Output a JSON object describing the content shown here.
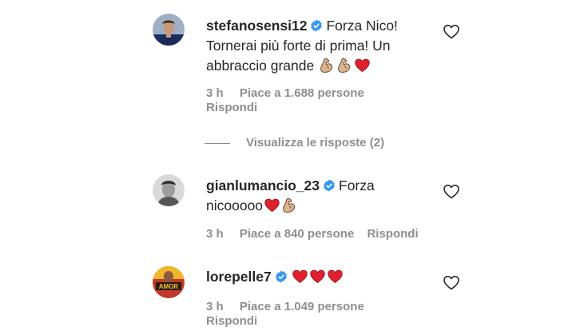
{
  "comments": [
    {
      "username": "stefanosensi12",
      "verified": true,
      "text_lines": [
        "Forza Nico!",
        "Tornerai più forte di prima! Un",
        "abbraccio grande"
      ],
      "emojis": [
        "flexed-biceps",
        "flexed-biceps",
        "red-heart"
      ],
      "time": "3 h",
      "likes": "Piace a 1.688 persone",
      "reply": "Rispondi",
      "view_replies": "Visualizza le risposte (2)"
    },
    {
      "username": "gianlumancio_23",
      "verified": true,
      "text_lines": [
        "Forza",
        "nicooooo"
      ],
      "emojis": [
        "red-heart",
        "flexed-biceps"
      ],
      "time": "3 h",
      "likes": "Piace a 840 persone",
      "reply": "Rispondi"
    },
    {
      "username": "lorepelle7",
      "verified": true,
      "text_lines": [],
      "emojis": [
        "red-heart",
        "red-heart",
        "red-heart"
      ],
      "avatar_text": "AMOR",
      "time": "3 h",
      "likes": "Piace a 1.049 persone",
      "reply": "Rispondi"
    }
  ],
  "colors": {
    "text": "#262626",
    "secondary": "#8e8e8e",
    "verified": "#3897f0",
    "heart": "#e0202e",
    "biceps": "#d9b48f"
  }
}
